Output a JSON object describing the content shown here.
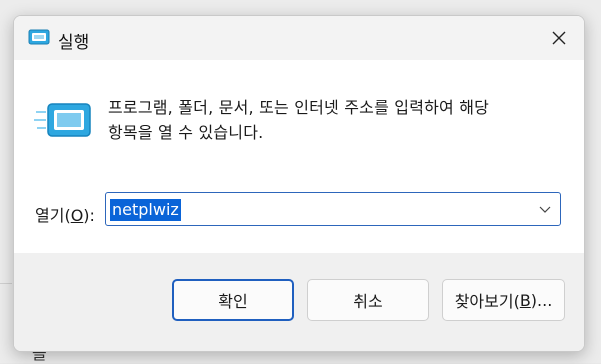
{
  "window": {
    "title": "실행",
    "close_glyph": "✕"
  },
  "main": {
    "description_line1": "프로그램, 폴더, 문서, 또는 인터넷 주소를 입력하여 해당",
    "description_line2": "항목을 열 수 있습니다.",
    "open_label_prefix": "열기(",
    "open_label_hotkey": "O",
    "open_label_suffix": "):",
    "open_value": "netplwiz"
  },
  "buttons": {
    "ok_label": "확인",
    "cancel_label": "취소",
    "browse_label_prefix": "찾아보기(",
    "browse_label_hotkey": "B",
    "browse_label_suffix": ")..."
  },
  "background": {
    "glyph": "을"
  },
  "colors": {
    "accent": "#0a64d8",
    "icon_blue": "#2ea7e0",
    "footer_bg": "#f0f0f0"
  },
  "icons": {
    "app_icon": "run-dialog-icon",
    "close_icon": "close-icon",
    "dropdown_icon": "chevron-down-icon"
  }
}
